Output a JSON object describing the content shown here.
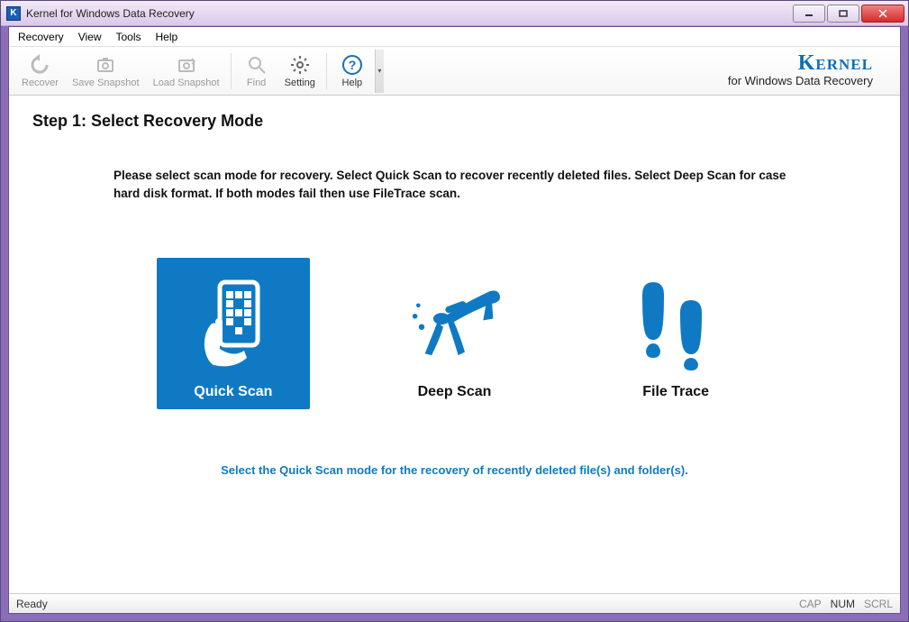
{
  "window": {
    "title": "Kernel for Windows Data Recovery"
  },
  "menubar": {
    "items": [
      "Recovery",
      "View",
      "Tools",
      "Help"
    ]
  },
  "toolbar": {
    "recover": "Recover",
    "save_snapshot": "Save Snapshot",
    "load_snapshot": "Load Snapshot",
    "find": "Find",
    "setting": "Setting",
    "help": "Help"
  },
  "brand": {
    "name": "Kernel",
    "tagline": "for Windows Data Recovery"
  },
  "step": {
    "title": "Step 1: Select Recovery Mode",
    "instructions": "Please select scan mode for recovery. Select Quick Scan to recover recently deleted files. Select Deep Scan for case hard disk format. If both modes fail then use FileTrace scan."
  },
  "modes": {
    "quick": "Quick Scan",
    "deep": "Deep Scan",
    "file_trace": "File Trace"
  },
  "hint": "Select the Quick Scan mode for the recovery of recently deleted file(s) and folder(s).",
  "statusbar": {
    "ready": "Ready",
    "cap": "CAP",
    "num": "NUM",
    "scrl": "SCRL"
  },
  "colors": {
    "accent": "#0f7ac3"
  }
}
